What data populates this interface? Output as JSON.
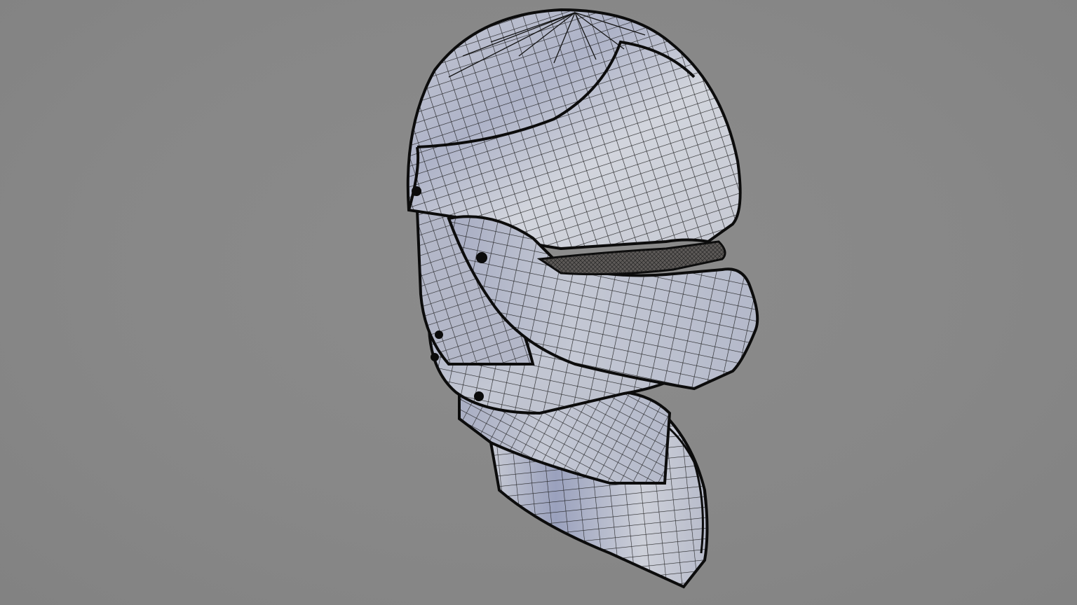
{
  "scene": {
    "subject_icon": "helmet-wireframe-icon",
    "background_color": "#8a8a8a",
    "surface_color": "#c9ccd6",
    "shadow_color": "#7f87a8",
    "wire_color": "#111111"
  }
}
